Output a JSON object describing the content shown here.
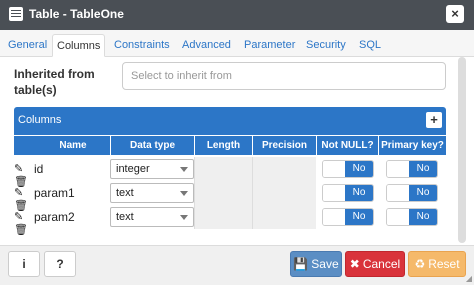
{
  "window": {
    "title": "Table - TableOne",
    "close": "×"
  },
  "tabs": [
    "General",
    "Columns",
    "Constraints",
    "Advanced",
    "Parameter",
    "Security",
    "SQL"
  ],
  "inherit": {
    "label": "Inherited from table(s)",
    "placeholder": "Select to inherit from"
  },
  "columns_grid": {
    "title": "Columns",
    "add": "+",
    "headers": [
      "Name",
      "Data type",
      "Length",
      "Precision",
      "Not NULL?",
      "Primary key?"
    ],
    "rows": [
      {
        "name": "id",
        "type": "integer",
        "not_null": "No",
        "primary_key": "No"
      },
      {
        "name": "param1",
        "type": "text",
        "not_null": "No",
        "primary_key": "No"
      },
      {
        "name": "param2",
        "type": "text",
        "not_null": "No",
        "primary_key": "No"
      }
    ]
  },
  "footer": {
    "info": "i",
    "help": "?",
    "save": "Save",
    "cancel": "Cancel",
    "reset": "Reset"
  },
  "colors": {
    "primary": "#2c76c7",
    "cancel": "#d9333b",
    "reset": "#f5b96a",
    "titlebar": "#4a4f55"
  }
}
